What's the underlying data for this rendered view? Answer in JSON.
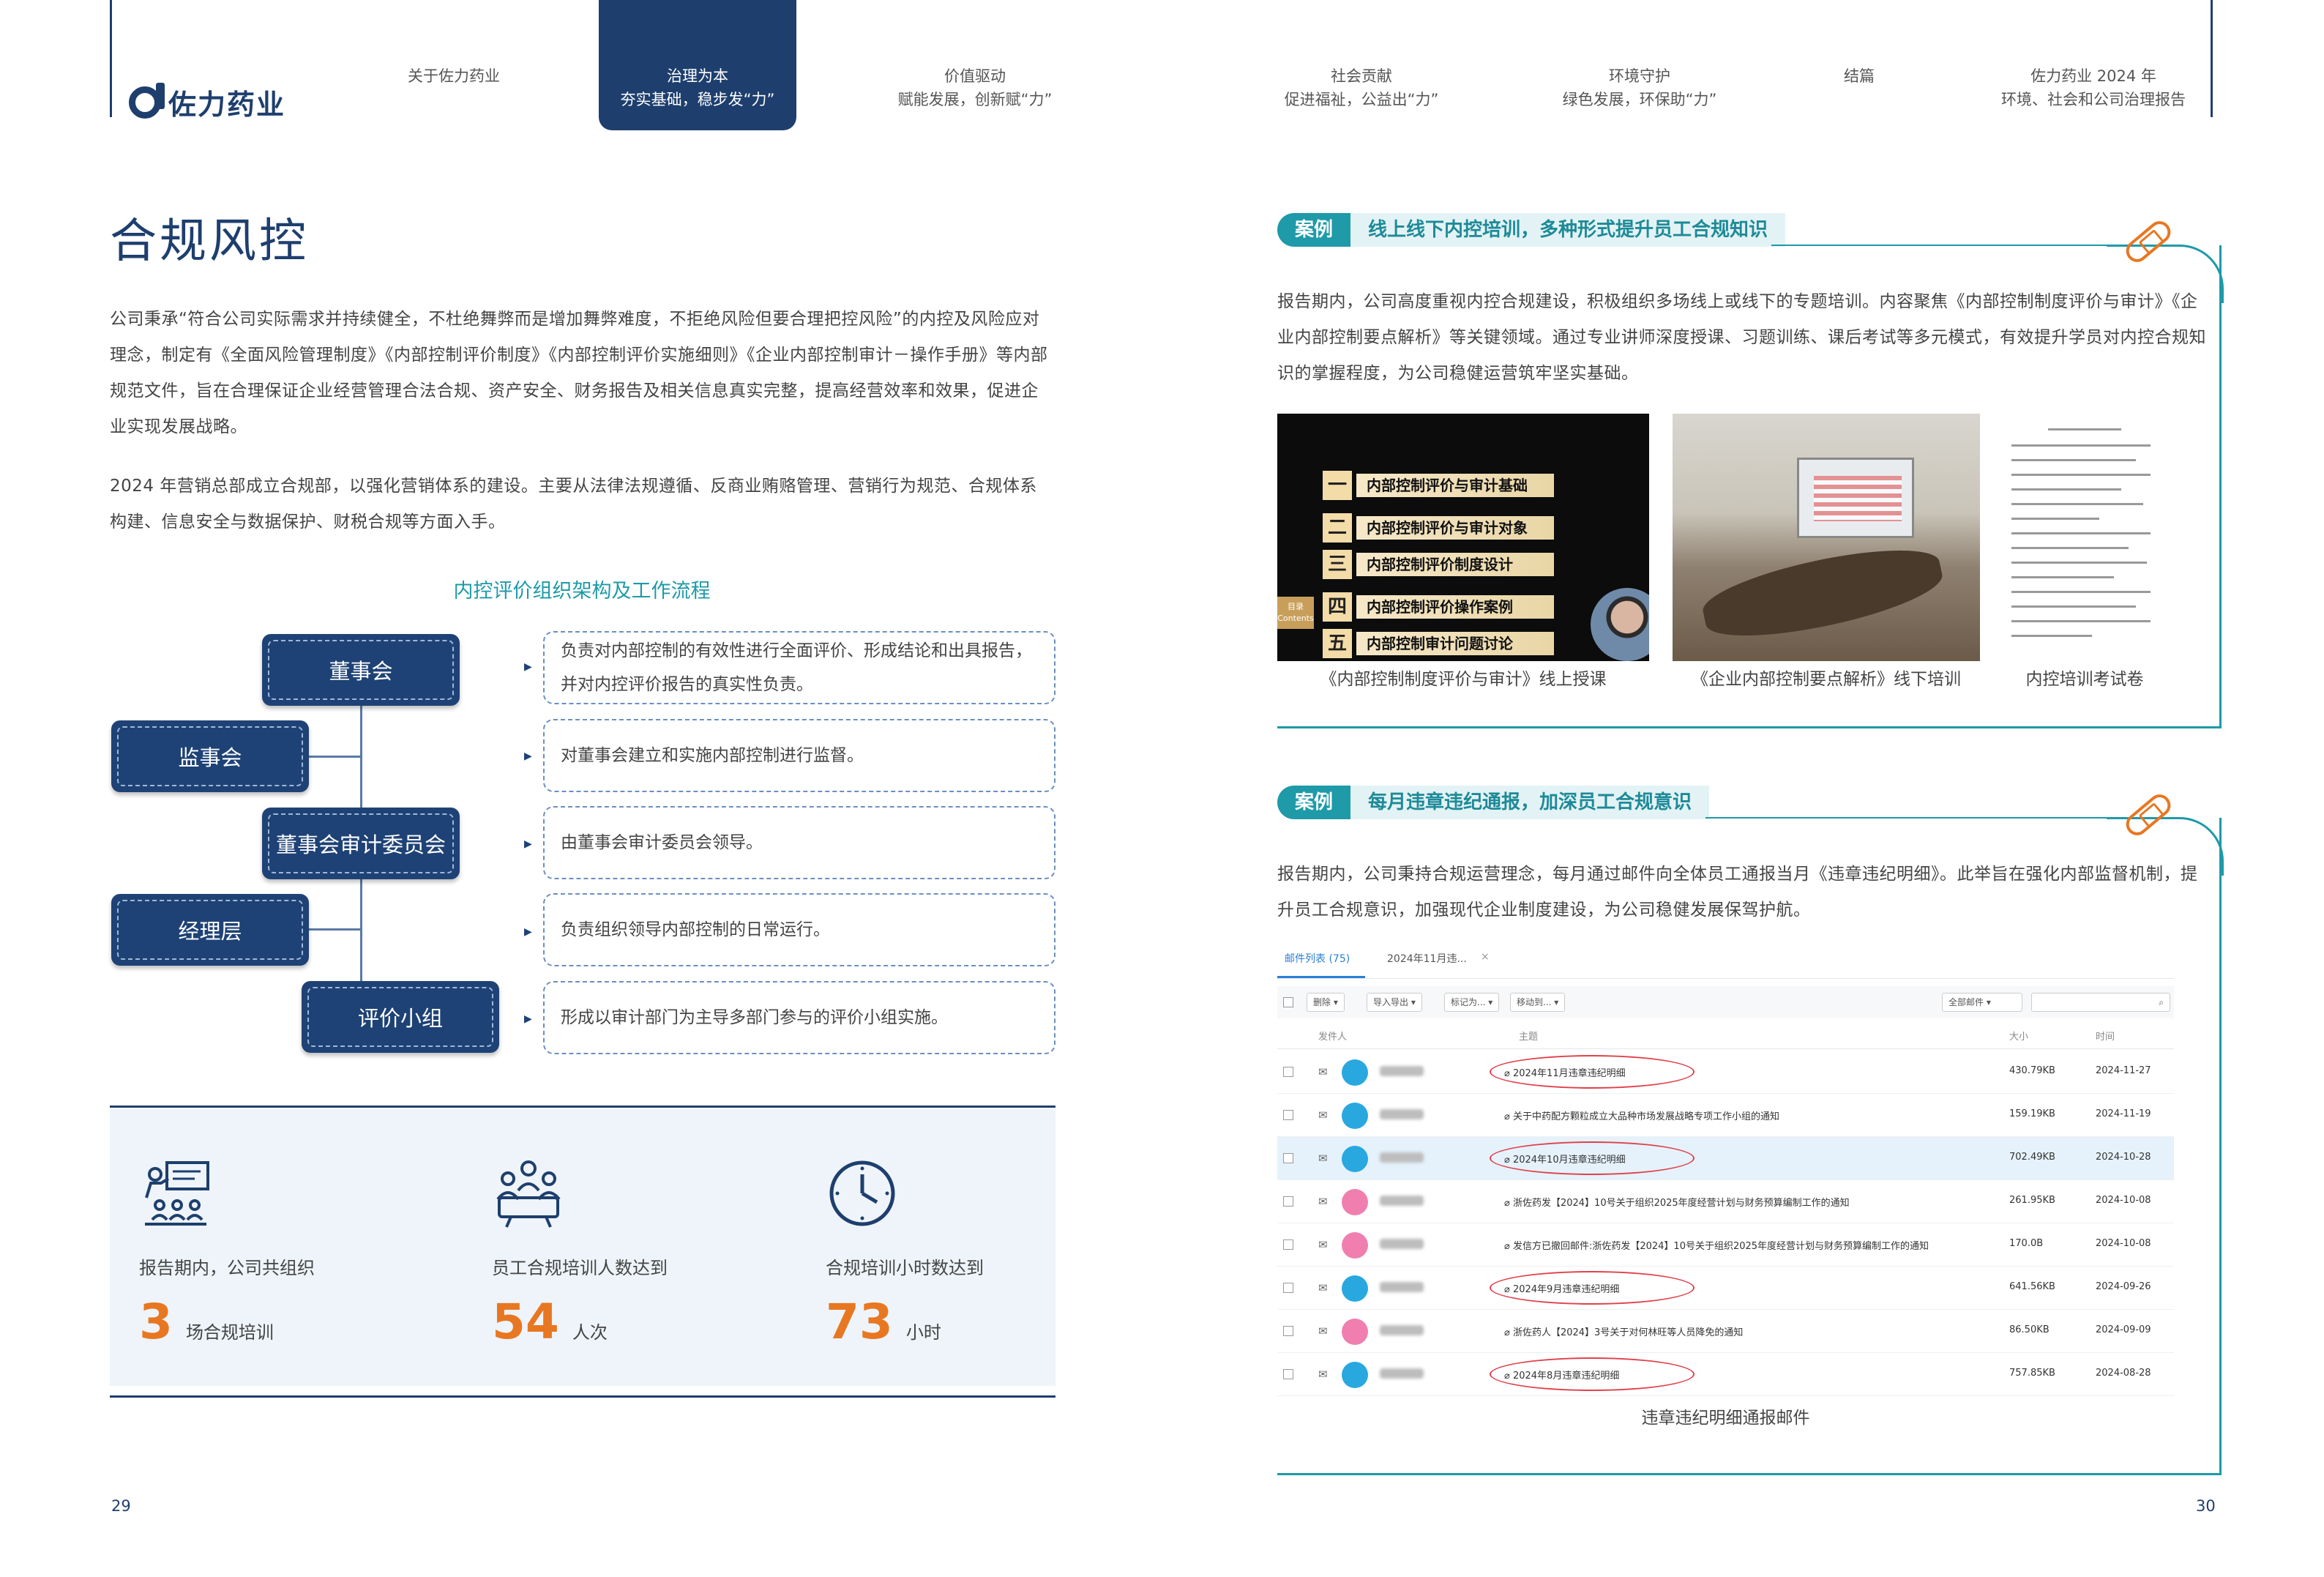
{
  "header": {
    "logo_text": "佐力药业",
    "nav": [
      {
        "line1": "关于佐力药业",
        "line2": ""
      },
      {
        "line1": "治理为本",
        "line2": "夯实基础，稳步发“力”"
      },
      {
        "line1": "价值驱动",
        "line2": "赋能发展，创新赋“力”"
      },
      {
        "line1": "社会贡献",
        "line2": "促进福祉，公益出“力”"
      },
      {
        "line1": "环境守护",
        "line2": "绿色发展，环保助“力”"
      },
      {
        "line1": "结篇",
        "line2": ""
      },
      {
        "line1": "佐力药业 2024 年",
        "line2": "环境、社会和公司治理报告"
      }
    ]
  },
  "left": {
    "title": "合规风控",
    "para1": "公司秉承“符合公司实际需求并持续健全，不杜绝舞弊而是增加舞弊难度，不拒绝风险但要合理把控风险”的内控及风险应对理念，制定有《全面风险管理制度》《内部控制评价制度》《内部控制评价实施细则》《企业内部控制审计－操作手册》等内部规范文件，旨在合理保证企业经营管理合法合规、资产安全、财务报告及相关信息真实完整，提高经营效率和效果，促进企业实现发展战略。",
    "para2": "2024 年营销总部成立合规部，以强化营销体系的建设。主要从法律法规遵循、反商业贿赂管理、营销行为规范、合规体系构建、信息安全与数据保护、财税合规等方面入手。",
    "org_title": "内控评价组织架构及工作流程",
    "org": [
      {
        "name": "董事会",
        "desc": "负责对内部控制的有效性进行全面评价、形成结论和出具报告，并对内控评价报告的真实性负责。"
      },
      {
        "name": "监事会",
        "desc": "对董事会建立和实施内部控制进行监督。"
      },
      {
        "name": "董事会审计委员会",
        "desc": "由董事会审计委员会领导。"
      },
      {
        "name": "经理层",
        "desc": "负责组织领导内部控制的日常运行。"
      },
      {
        "name": "评价小组",
        "desc": "形成以审计部门为主导多部门参与的评价小组实施。"
      }
    ],
    "stats": [
      {
        "icon": "training-icon",
        "label": "报告期内，公司共组织",
        "value": "3",
        "unit": "场合规培训"
      },
      {
        "icon": "people-icon",
        "label": "员工合规培训人数达到",
        "value": "54",
        "unit": "人次"
      },
      {
        "icon": "clock-icon",
        "label": "合规培训小时数达到",
        "value": "73",
        "unit": "小时"
      }
    ],
    "page_number": "29"
  },
  "right": {
    "case1": {
      "tag": "案例",
      "title": "线上线下内控培训，多种形式提升员工合规知识",
      "text": "报告期内，公司高度重视内控合规建设，积极组织多场线上或线下的专题培训。内容聚焦《内部控制制度评价与审计》《企业内部控制要点解析》等关键领域。通过专业讲师深度授课、习题训练、课后考试等多元模式，有效提升学员对内控合规知识的掌握程度，为公司稳健运营筑牢坚实基础。",
      "slide": {
        "side_label": "目录",
        "side_sub": "Contents",
        "items": [
          {
            "num": "一",
            "label": "内部控制评价与审计基础"
          },
          {
            "num": "二",
            "label": "内部控制评价与审计对象"
          },
          {
            "num": "三",
            "label": "内部控制评价制度设计"
          },
          {
            "num": "四",
            "label": "内部控制评价操作案例"
          },
          {
            "num": "五",
            "label": "内部控制审计问题讨论"
          }
        ]
      },
      "captions": [
        "《内部控制制度评价与审计》线上授课",
        "《企业内部控制要点解析》线下培训",
        "内控培训考试卷"
      ]
    },
    "case2": {
      "tag": "案例",
      "title": "每月违章违纪通报，加深员工合规意识",
      "text": "报告期内，公司秉持合规运营理念，每月通过邮件向全体员工通报当月《违章违纪明细》。此举旨在强化内部监督机制，提升员工合规意识，加强现代企业制度建设，为公司稳健发展保驾护航。",
      "mail": {
        "tab1": "邮件列表 (75)",
        "tab2": "2024年11月违...",
        "toolbar": [
          "删除",
          "导入导出",
          "标记为...",
          "移动到..."
        ],
        "filter": "全部邮件",
        "columns": {
          "from": "发件人",
          "subject": "主题",
          "size": "大小",
          "date": "时间"
        },
        "rows": [
          {
            "subject": "2024年11月违章违纪明细",
            "size": "430.79KB",
            "date": "2024-11-27",
            "avatar": "#29a8e0",
            "circled": true,
            "selected": false
          },
          {
            "subject": "关于中药配方颗粒成立大品种市场发展战略专项工作小组的通知",
            "size": "159.19KB",
            "date": "2024-11-19",
            "avatar": "#29a8e0",
            "circled": false,
            "selected": false
          },
          {
            "subject": "2024年10月违章违纪明细",
            "size": "702.49KB",
            "date": "2024-10-28",
            "avatar": "#29a8e0",
            "circled": true,
            "selected": true
          },
          {
            "subject": "浙佐药发【2024】10号关于组织2025年度经营计划与财务预算编制工作的通知",
            "size": "261.95KB",
            "date": "2024-10-08",
            "avatar": "#f07fb0",
            "circled": false,
            "selected": false
          },
          {
            "subject": "发信方已撤回邮件:浙佐药发【2024】10号关于组织2025年度经营计划与财务预算编制工作的通知",
            "size": "170.0B",
            "date": "2024-10-08",
            "avatar": "#f07fb0",
            "circled": false,
            "selected": false
          },
          {
            "subject": "2024年9月违章违纪明细",
            "size": "641.56KB",
            "date": "2024-09-26",
            "avatar": "#29a8e0",
            "circled": true,
            "selected": false
          },
          {
            "subject": "浙佐药人【2024】3号关于对何林旺等人员降免的通知",
            "size": "86.50KB",
            "date": "2024-09-09",
            "avatar": "#f07fb0",
            "circled": false,
            "selected": false
          },
          {
            "subject": "2024年8月违章违纪明细",
            "size": "757.85KB",
            "date": "2024-08-28",
            "avatar": "#29a8e0",
            "circled": true,
            "selected": false
          }
        ]
      },
      "caption": "违章违纪明细通报邮件"
    },
    "page_number": "30"
  }
}
